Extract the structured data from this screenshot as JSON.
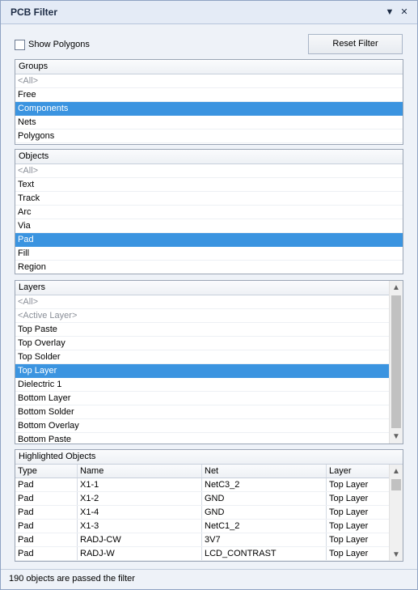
{
  "window": {
    "title": "PCB Filter"
  },
  "icons": {
    "menu": "dropdown-arrow-icon",
    "close": "close-icon"
  },
  "controls": {
    "show_polygons_label": "Show Polygons",
    "reset_label": "Reset Filter"
  },
  "groups": {
    "header": "Groups",
    "items": [
      {
        "label": "<All>",
        "muted": true
      },
      {
        "label": "Free"
      },
      {
        "label": "Components",
        "selected": true
      },
      {
        "label": "Nets"
      },
      {
        "label": "Polygons"
      }
    ]
  },
  "objects": {
    "header": "Objects",
    "items": [
      {
        "label": "<All>",
        "muted": true
      },
      {
        "label": "Text"
      },
      {
        "label": "Track"
      },
      {
        "label": "Arc"
      },
      {
        "label": "Via"
      },
      {
        "label": "Pad",
        "selected": true
      },
      {
        "label": "Fill"
      },
      {
        "label": "Region"
      }
    ]
  },
  "layers": {
    "header": "Layers",
    "items": [
      {
        "label": "<All>",
        "muted": true
      },
      {
        "label": "<Active Layer>",
        "muted": true
      },
      {
        "label": "Top Paste"
      },
      {
        "label": "Top Overlay"
      },
      {
        "label": "Top Solder"
      },
      {
        "label": "Top Layer",
        "selected": true
      },
      {
        "label": "Dielectric 1"
      },
      {
        "label": "Bottom Layer"
      },
      {
        "label": "Bottom Solder"
      },
      {
        "label": "Bottom Overlay"
      },
      {
        "label": "Bottom Paste"
      }
    ]
  },
  "highlighted": {
    "header": "Highlighted Objects",
    "columns": [
      "Type",
      "Name",
      "Net",
      "Layer"
    ],
    "rows": [
      [
        "Pad",
        "X1-1",
        "NetC3_2",
        "Top Layer"
      ],
      [
        "Pad",
        "X1-2",
        "GND",
        "Top Layer"
      ],
      [
        "Pad",
        "X1-4",
        "GND",
        "Top Layer"
      ],
      [
        "Pad",
        "X1-3",
        "NetC1_2",
        "Top Layer"
      ],
      [
        "Pad",
        "RADJ-CW",
        "3V7",
        "Top Layer"
      ],
      [
        "Pad",
        "RADJ-W",
        "LCD_CONTRAST",
        "Top Layer"
      ]
    ]
  },
  "status": {
    "text": "190 objects are passed the filter"
  },
  "colors": {
    "selection": "#3b94e0",
    "muted_text": "#8a8f98",
    "title_text": "#1d2c45"
  }
}
